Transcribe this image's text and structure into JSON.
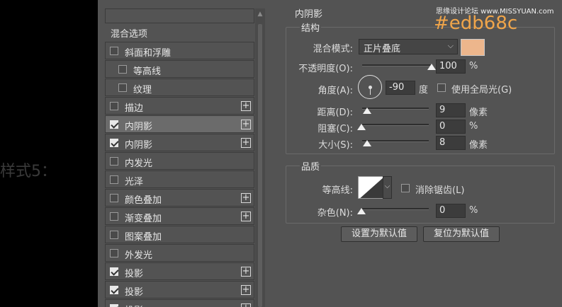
{
  "canvas": {
    "style_label": "样式5："
  },
  "watermark": "思缘设计论坛 www.MISSYUAN.com",
  "annotation": "#edb68c",
  "style_list": {
    "header": "混合选项",
    "items": [
      {
        "label": "斜面和浮雕",
        "checked": false,
        "plus": false,
        "indent": false,
        "selected": false
      },
      {
        "label": "等高线",
        "checked": false,
        "plus": false,
        "indent": true,
        "selected": false
      },
      {
        "label": "纹理",
        "checked": false,
        "plus": false,
        "indent": true,
        "selected": false
      },
      {
        "label": "描边",
        "checked": false,
        "plus": true,
        "indent": false,
        "selected": false
      },
      {
        "label": "内阴影",
        "checked": true,
        "plus": true,
        "indent": false,
        "selected": true
      },
      {
        "label": "内阴影",
        "checked": true,
        "plus": true,
        "indent": false,
        "selected": false
      },
      {
        "label": "内发光",
        "checked": false,
        "plus": false,
        "indent": false,
        "selected": false
      },
      {
        "label": "光泽",
        "checked": false,
        "plus": false,
        "indent": false,
        "selected": false
      },
      {
        "label": "颜色叠加",
        "checked": false,
        "plus": true,
        "indent": false,
        "selected": false
      },
      {
        "label": "渐变叠加",
        "checked": false,
        "plus": true,
        "indent": false,
        "selected": false
      },
      {
        "label": "图案叠加",
        "checked": false,
        "plus": false,
        "indent": false,
        "selected": false
      },
      {
        "label": "外发光",
        "checked": false,
        "plus": false,
        "indent": false,
        "selected": false
      },
      {
        "label": "投影",
        "checked": true,
        "plus": true,
        "indent": false,
        "selected": false
      },
      {
        "label": "投影",
        "checked": true,
        "plus": true,
        "indent": false,
        "selected": false
      },
      {
        "label": "投影",
        "checked": true,
        "plus": true,
        "indent": false,
        "selected": false
      }
    ]
  },
  "panel": {
    "title": "内阴影",
    "structure": {
      "title": "结构",
      "blend_mode_label": "混合模式:",
      "blend_mode_value": "正片叠底",
      "color": "#edb68c",
      "opacity_label": "不透明度(O):",
      "opacity_value": "100",
      "opacity_fraction": 1.0,
      "angle_label": "角度(A):",
      "angle_value": "-90",
      "angle_unit": "度",
      "global_light_label": "使用全局光(G)",
      "distance_label": "距离(D):",
      "distance_value": "9",
      "choke_label": "阻塞(C):",
      "choke_value": "0",
      "size_label": "大小(S):",
      "size_value": "8",
      "unit_px": "像素",
      "unit_pct": "%"
    },
    "quality": {
      "title": "品质",
      "contour_label": "等高线:",
      "antialias_label": "消除锯齿(L)",
      "noise_label": "杂色(N):",
      "noise_value": "0"
    },
    "buttons": {
      "make_default": "设置为默认值",
      "reset_default": "复位为默认值"
    }
  }
}
